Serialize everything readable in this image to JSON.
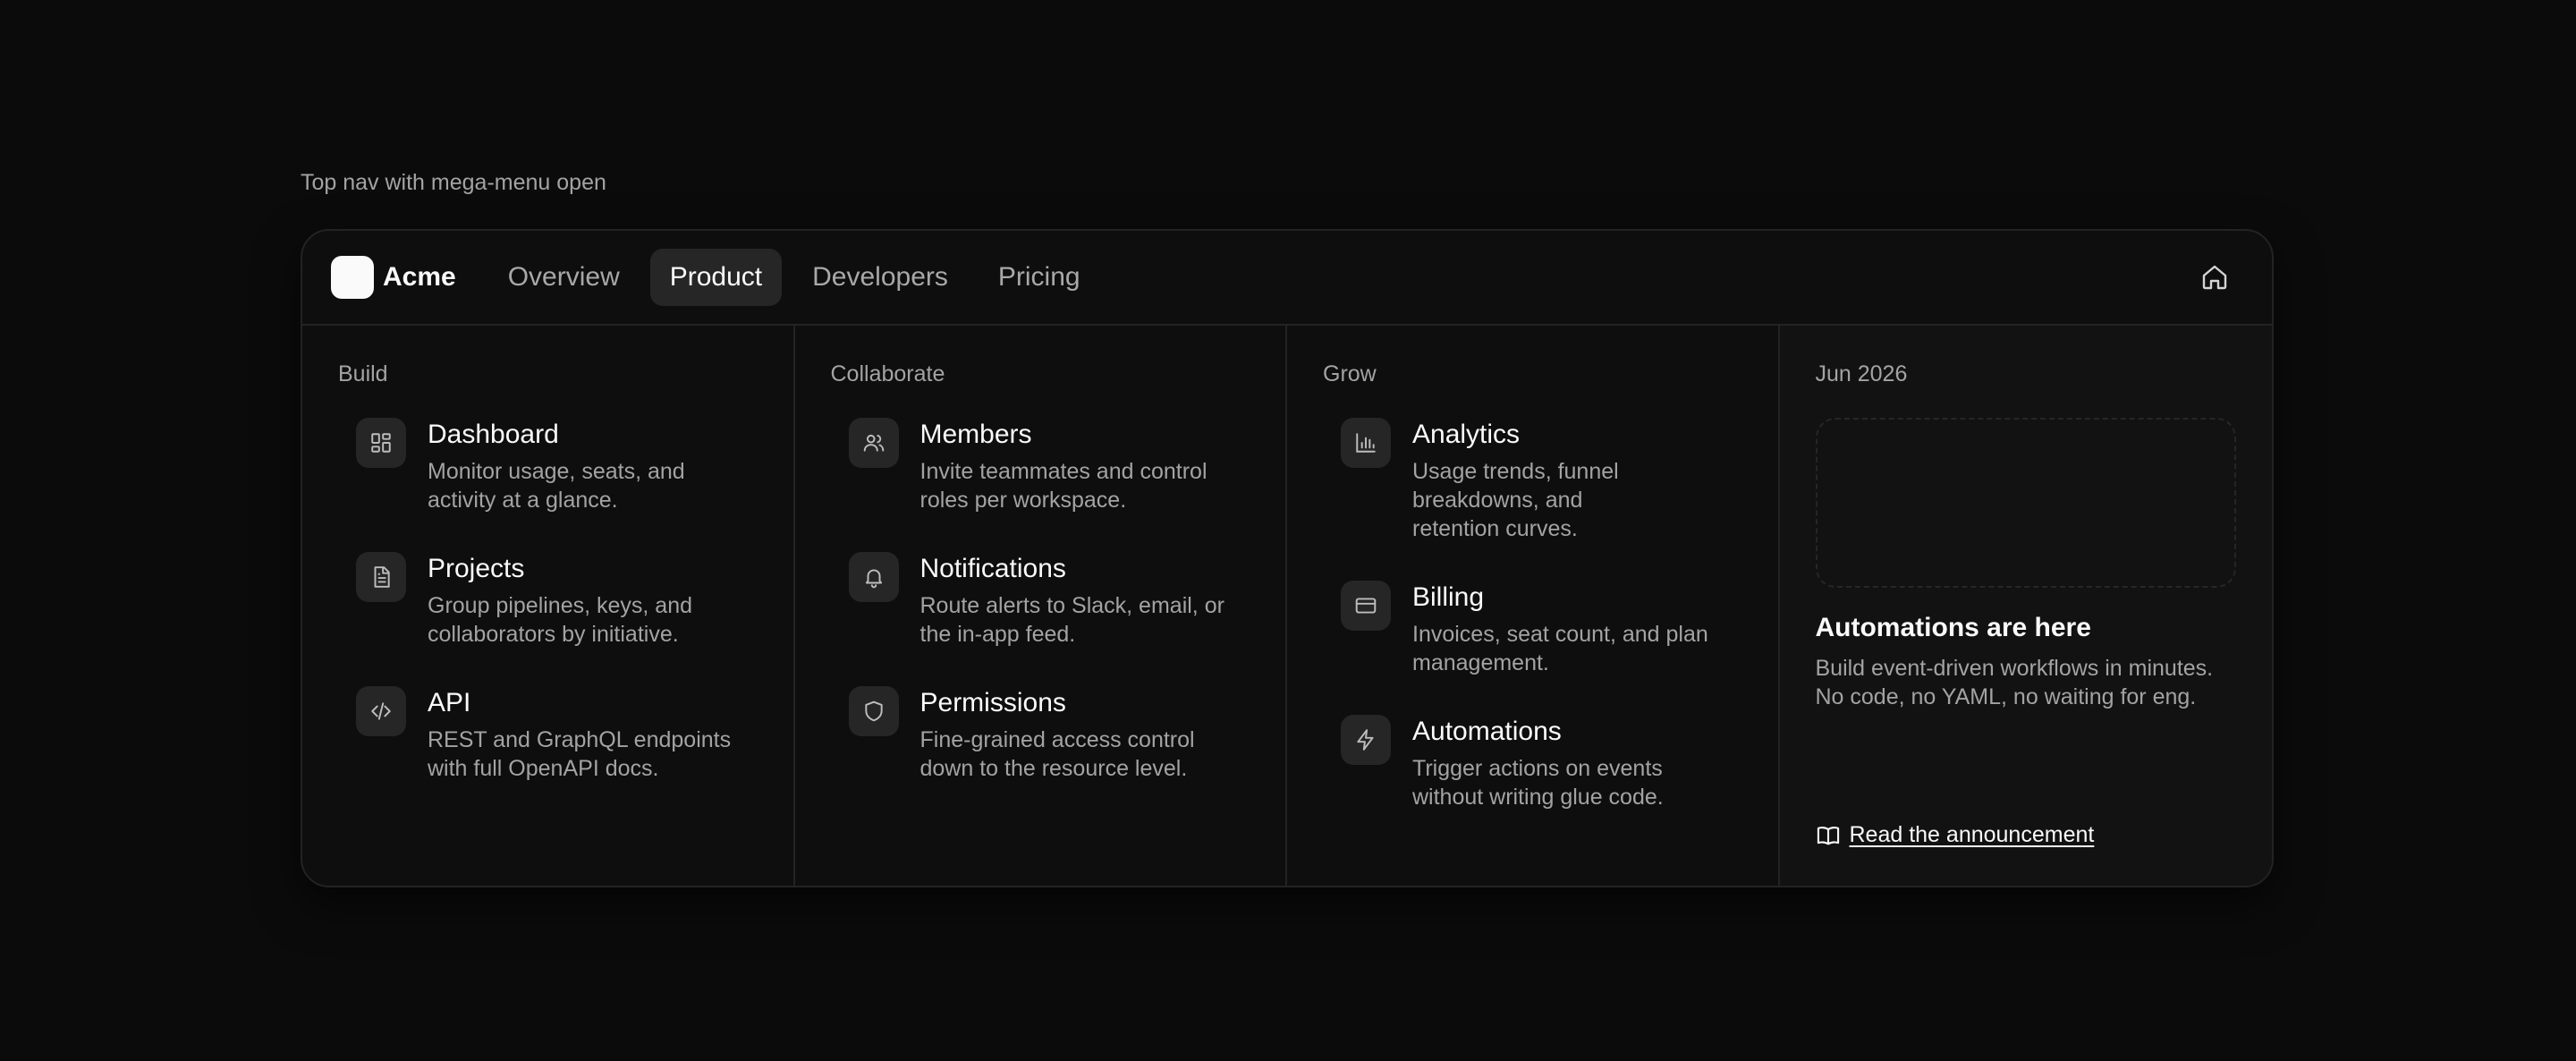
{
  "caption": "Top nav with mega-menu open",
  "brand": {
    "name": "Acme"
  },
  "nav": {
    "items": [
      {
        "label": "Overview",
        "active": false
      },
      {
        "label": "Product",
        "active": true
      },
      {
        "label": "Developers",
        "active": false
      },
      {
        "label": "Pricing",
        "active": false
      }
    ],
    "home_icon": "home-icon"
  },
  "menu": {
    "columns": [
      {
        "title": "Build",
        "items": [
          {
            "icon": "dashboard-icon",
            "title": "Dashboard",
            "desc": "Monitor usage, seats, and activity at a glance."
          },
          {
            "icon": "document-icon",
            "title": "Projects",
            "desc": "Group pipelines, keys, and collaborators by initiative."
          },
          {
            "icon": "code-icon",
            "title": "API",
            "desc": "REST and GraphQL endpoints with full OpenAPI docs."
          }
        ]
      },
      {
        "title": "Collaborate",
        "items": [
          {
            "icon": "users-icon",
            "title": "Members",
            "desc": "Invite teammates and control roles per workspace."
          },
          {
            "icon": "bell-icon",
            "title": "Notifications",
            "desc": "Route alerts to Slack, email, or the in-app feed."
          },
          {
            "icon": "shield-icon",
            "title": "Permissions",
            "desc": "Fine-grained access control down to the resource level."
          }
        ]
      },
      {
        "title": "Grow",
        "items": [
          {
            "icon": "bar-chart-icon",
            "title": "Analytics",
            "desc": "Usage trends, funnel breakdowns, and retention curves."
          },
          {
            "icon": "credit-card-icon",
            "title": "Billing",
            "desc": "Invoices, seat count, and plan management."
          },
          {
            "icon": "lightning-icon",
            "title": "Automations",
            "desc": "Trigger actions on events without writing glue code."
          }
        ]
      }
    ],
    "feature": {
      "date": "Jun 2026",
      "title": "Automations are here",
      "desc": "Build event-driven workflows in minutes. No code, no YAML, no waiting for eng.",
      "link_label": "Read the announcement",
      "link_icon": "book-icon"
    }
  },
  "colors": {
    "background": "#0b0b0b",
    "surface": "#0e0e0e",
    "border": "#232323",
    "active_tab": "#262626",
    "text": "#fafafa",
    "muted": "#a3a3a3"
  }
}
